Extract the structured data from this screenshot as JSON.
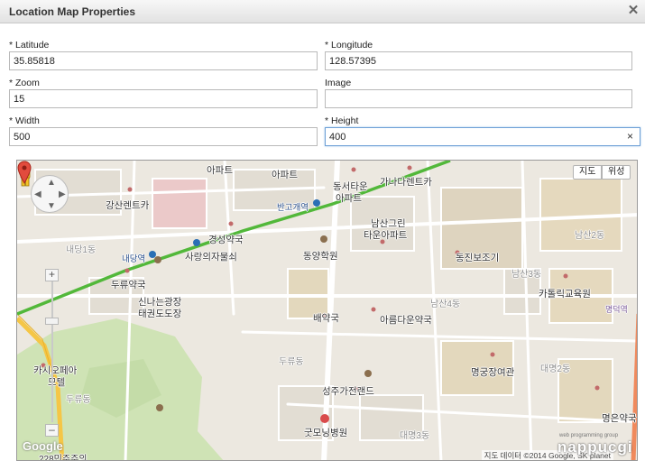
{
  "dialog": {
    "title": "Location Map Properties",
    "close_symbol": "✕"
  },
  "form": {
    "latitude": {
      "label": "* Latitude",
      "value": "35.85818"
    },
    "longitude": {
      "label": "* Longitude",
      "value": "128.57395"
    },
    "zoom": {
      "label": "* Zoom",
      "value": "15"
    },
    "image": {
      "label": "Image",
      "value": ""
    },
    "width": {
      "label": "* Width",
      "value": "500"
    },
    "height": {
      "label": "* Height",
      "value": "400",
      "clear_symbol": "×"
    }
  },
  "map": {
    "type_buttons": {
      "map": "지도",
      "satellite": "위성"
    },
    "zoom_in": "+",
    "zoom_out": "–",
    "logo": "Google",
    "attribution": "지도 데이터 ©2014 Google, SK planet",
    "watermark": "nappucgi",
    "watermark_small": "web programming group",
    "poi": {
      "hotel_top": "아파트",
      "apart_top": "아파트",
      "gangsan": "강산렌트카",
      "ganada": "가나다렌트카",
      "dongseo1": "동서타운",
      "dongseo2": "아파트",
      "bangogae": "반고개역",
      "namsan_green1": "남산그린",
      "namsan_green2": "타운아파트",
      "naedang1": "내당1동",
      "gyeongseong": "경성약국",
      "sarang": "사랑의자물쇠",
      "naedang_station": "내당역",
      "dongyang": "동양학원",
      "dongjin": "동진보조기",
      "namsan2": "남산2동",
      "namsan3": "남산3동",
      "duryu_pharm": "두류약국",
      "sinnaneun1": "신나는광장",
      "sinnaneun2": "태권도도장",
      "catholic": "카톨릭교육원",
      "namsan4": "남산4동",
      "myeongdeok": "명덕역",
      "baeyak": "배약국",
      "areum": "아름다운약국",
      "cassiopeia1": "카시오페아",
      "cassiopeia2": "모텔",
      "duryu_dong": "두류동",
      "myeonggung": "명궁장여관",
      "daemyeong2": "대명2동",
      "duryu_dong2": "두류동",
      "seongju": "성주가전랜드",
      "gutmoning": "굿모닝병원",
      "daemyeong3": "대명3동",
      "myeongeun": "명은약국",
      "bottom_left": "228민주주의"
    }
  }
}
